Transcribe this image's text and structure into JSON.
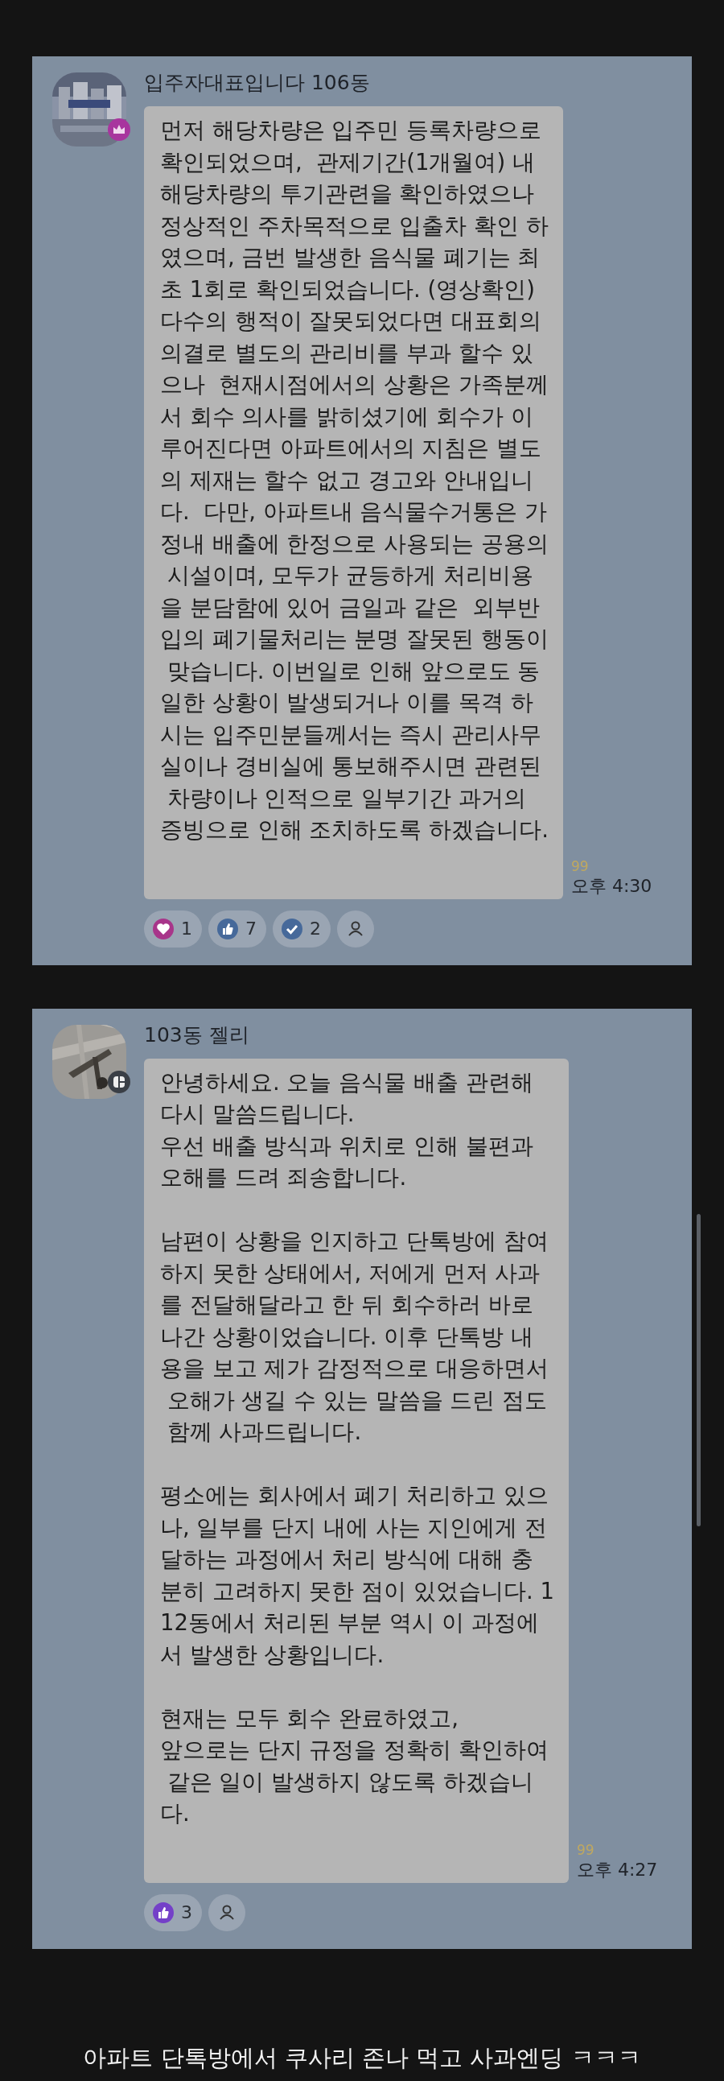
{
  "messages": [
    {
      "sender": "입주자대표입니다 106동",
      "badge": {
        "kind": "crown"
      },
      "text": "먼저 해당차량은 입주민 등록차량으로\n확인되었으며,  관제기간(1개월여) 내\n해당차량의 투기관련을 확인하였으나\n정상적인 주차목적으로 입출차 확인 하\n였으며, 금번 발생한 음식물 폐기는 최\n초 1회로 확인되었습니다. (영상확인)\n다수의 행적이 잘못되었다면 대표회의\n의결로 별도의 관리비를 부과 할수 있\n으나  현재시점에서의 상황은 가족분께\n서 회수 의사를 밝히셨기에 회수가 이\n루어진다면 아파트에서의 지침은 별도\n의 제재는 할수 없고 경고와 안내입니\n다.  다만, 아파트내 음식물수거통은 가\n정내 배출에 한정으로 사용되는 공용의\n 시설이며, 모두가 균등하게 처리비용\n을 분담함에 있어 금일과 같은  외부반\n입의 폐기물처리는 분명 잘못된 행동이\n 맞습니다. 이번일로 인해 앞으로도 동\n일한 상황이 발생되거나 이를 목격 하\n시는 입주민분들께서는 즉시 관리사무\n실이나 경비실에 통보해주시면 관련된\n 차량이나 인적으로 일부기간 과거의\n증빙으로 인해 조치하도록 하겠습니다.",
      "read_count": "99",
      "time": "오후 4:30",
      "reactions": [
        {
          "kind": "heart",
          "color": "#a8358a",
          "count": "1"
        },
        {
          "kind": "like",
          "color": "#46699a",
          "count": "7"
        },
        {
          "kind": "check",
          "color": "#46699a",
          "count": "2"
        },
        {
          "kind": "add"
        }
      ]
    },
    {
      "sender": "103동 젤리",
      "badge": {
        "kind": "square"
      },
      "text": "안녕하세요. 오늘 음식물 배출 관련해\n다시 말씀드립니다.\n우선 배출 방식과 위치로 인해 불편과\n오해를 드려 죄송합니다.\n\n남편이 상황을 인지하고 단톡방에 참여\n하지 못한 상태에서, 저에게 먼저 사과\n를 전달해달라고 한 뒤 회수하러 바로\n나간 상황이었습니다. 이후 단톡방 내\n용을 보고 제가 감정적으로 대응하면서\n 오해가 생길 수 있는 말씀을 드린 점도\n 함께 사과드립니다.\n\n평소에는 회사에서 폐기 처리하고 있으\n나, 일부를 단지 내에 사는 지인에게 전\n달하는 과정에서 처리 방식에 대해 충\n분히 고려하지 못한 점이 있었습니다. 1\n12동에서 처리된 부분 역시 이 과정에\n서 발생한 상황입니다.\n\n현재는 모두 회수 완료하였고,\n앞으로는 단지 규정을 정확히 확인하여\n 같은 일이 발생하지 않도록 하겠습니\n다.",
      "read_count": "99",
      "time": "오후 4:27",
      "reactions": [
        {
          "kind": "like",
          "color": "#7440c8",
          "count": "3"
        },
        {
          "kind": "add"
        }
      ]
    }
  ],
  "caption": "아파트 단톡방에서 쿠사리 존나 먹고 사과엔딩 ㅋㅋㅋ"
}
